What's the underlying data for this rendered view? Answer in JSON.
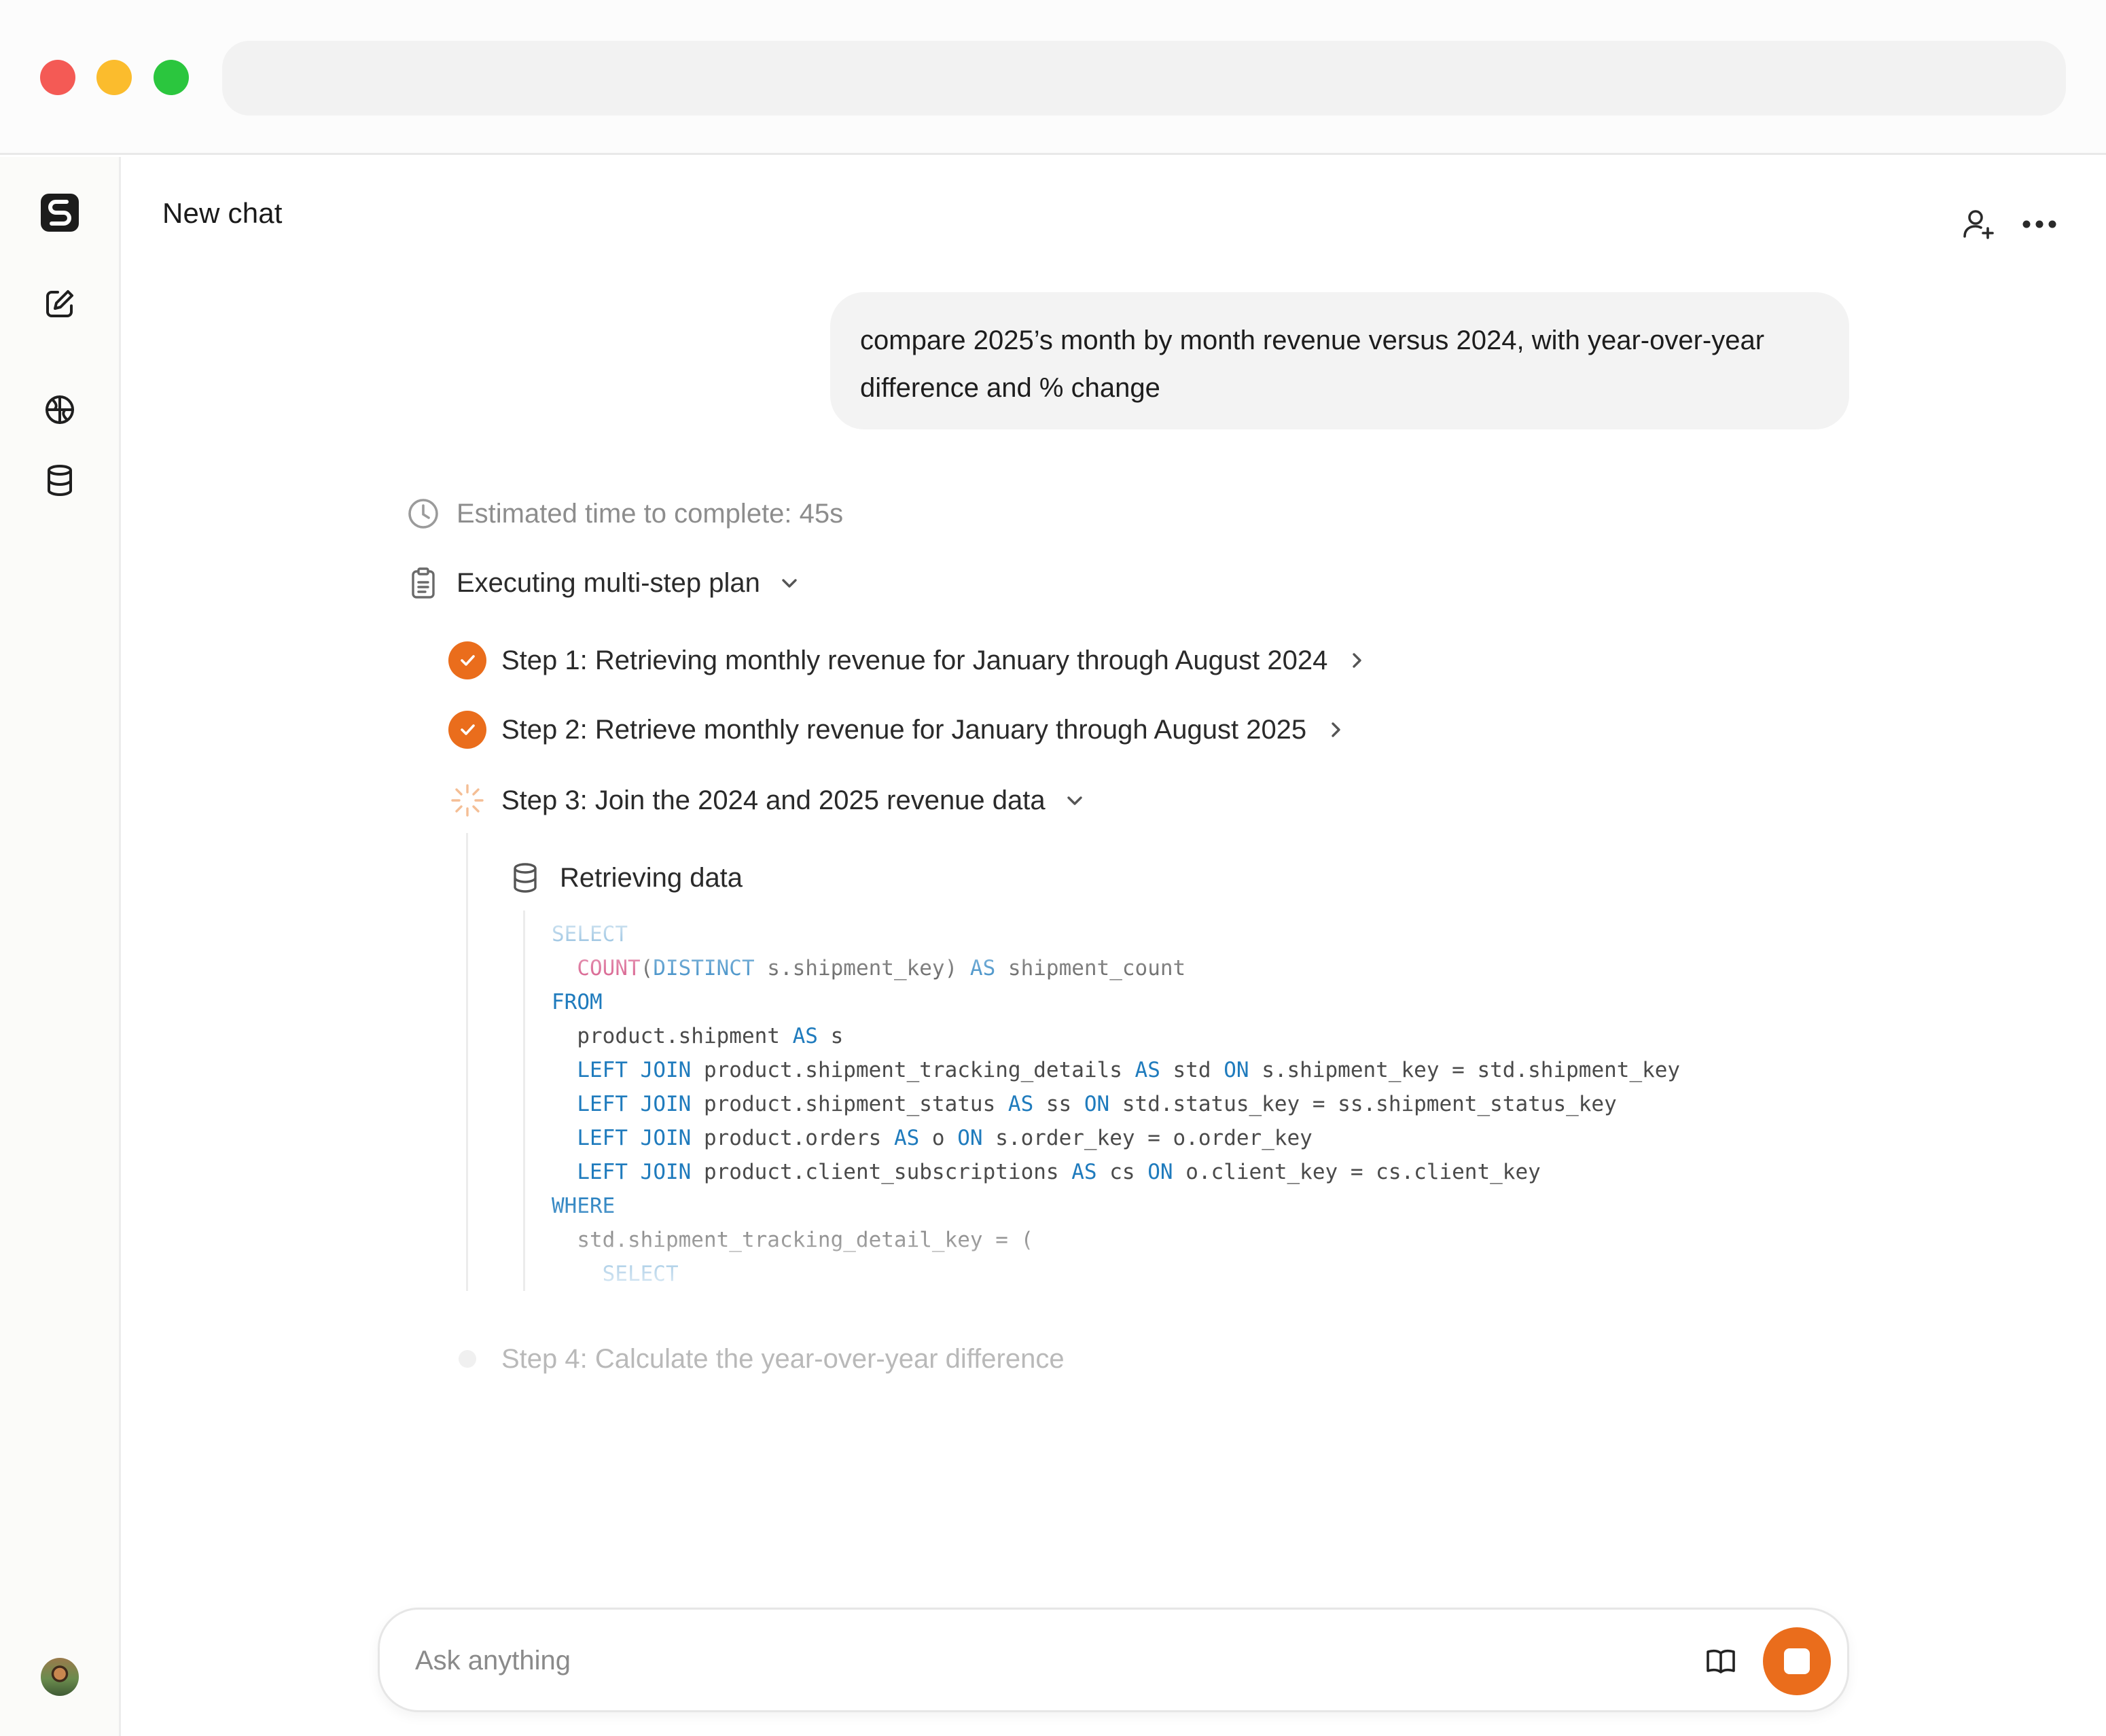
{
  "window": {
    "address_bar": ""
  },
  "header": {
    "title": "New chat"
  },
  "sidebar": {
    "items": [
      {
        "name": "logo",
        "icon": "app-logo-icon"
      },
      {
        "name": "new-chat",
        "icon": "compose-icon"
      },
      {
        "name": "explore",
        "icon": "globe-icon"
      },
      {
        "name": "data",
        "icon": "database-icon"
      }
    ]
  },
  "chat": {
    "user_message": "compare 2025’s month by month revenue versus 2024, with year-over-year difference and % change",
    "estimate": "Estimated time to complete: 45s",
    "plan_label": "Executing multi-step plan",
    "steps": [
      {
        "label": "Step 1: Retrieving monthly revenue for January through August 2024",
        "status": "done"
      },
      {
        "label": "Step 2: Retrieve monthly revenue for January through August 2025",
        "status": "done"
      },
      {
        "label": "Step 3: Join the 2024 and 2025 revenue data",
        "status": "in-progress"
      },
      {
        "label": "Step 4: Calculate the year-over-year difference",
        "status": "pending"
      }
    ],
    "substep_label": "Retrieving data",
    "sql": [
      "SELECT",
      "  COUNT(DISTINCT s.shipment_key) AS shipment_count",
      "FROM",
      "  product.shipment AS s",
      "  LEFT JOIN product.shipment_tracking_details AS std ON s.shipment_key = std.shipment_key",
      "  LEFT JOIN product.shipment_status AS ss ON std.status_key = ss.shipment_status_key",
      "  LEFT JOIN product.orders AS o ON s.order_key = o.order_key",
      "  LEFT JOIN product.client_subscriptions AS cs ON o.client_key = cs.client_key",
      "WHERE",
      "  std.shipment_tracking_detail_key = (",
      "    SELECT"
    ]
  },
  "composer": {
    "placeholder": "Ask anything"
  },
  "colors": {
    "accent": "#ea6d1c",
    "sql_keyword": "#1f7bbd",
    "sql_function": "#d1457a"
  }
}
